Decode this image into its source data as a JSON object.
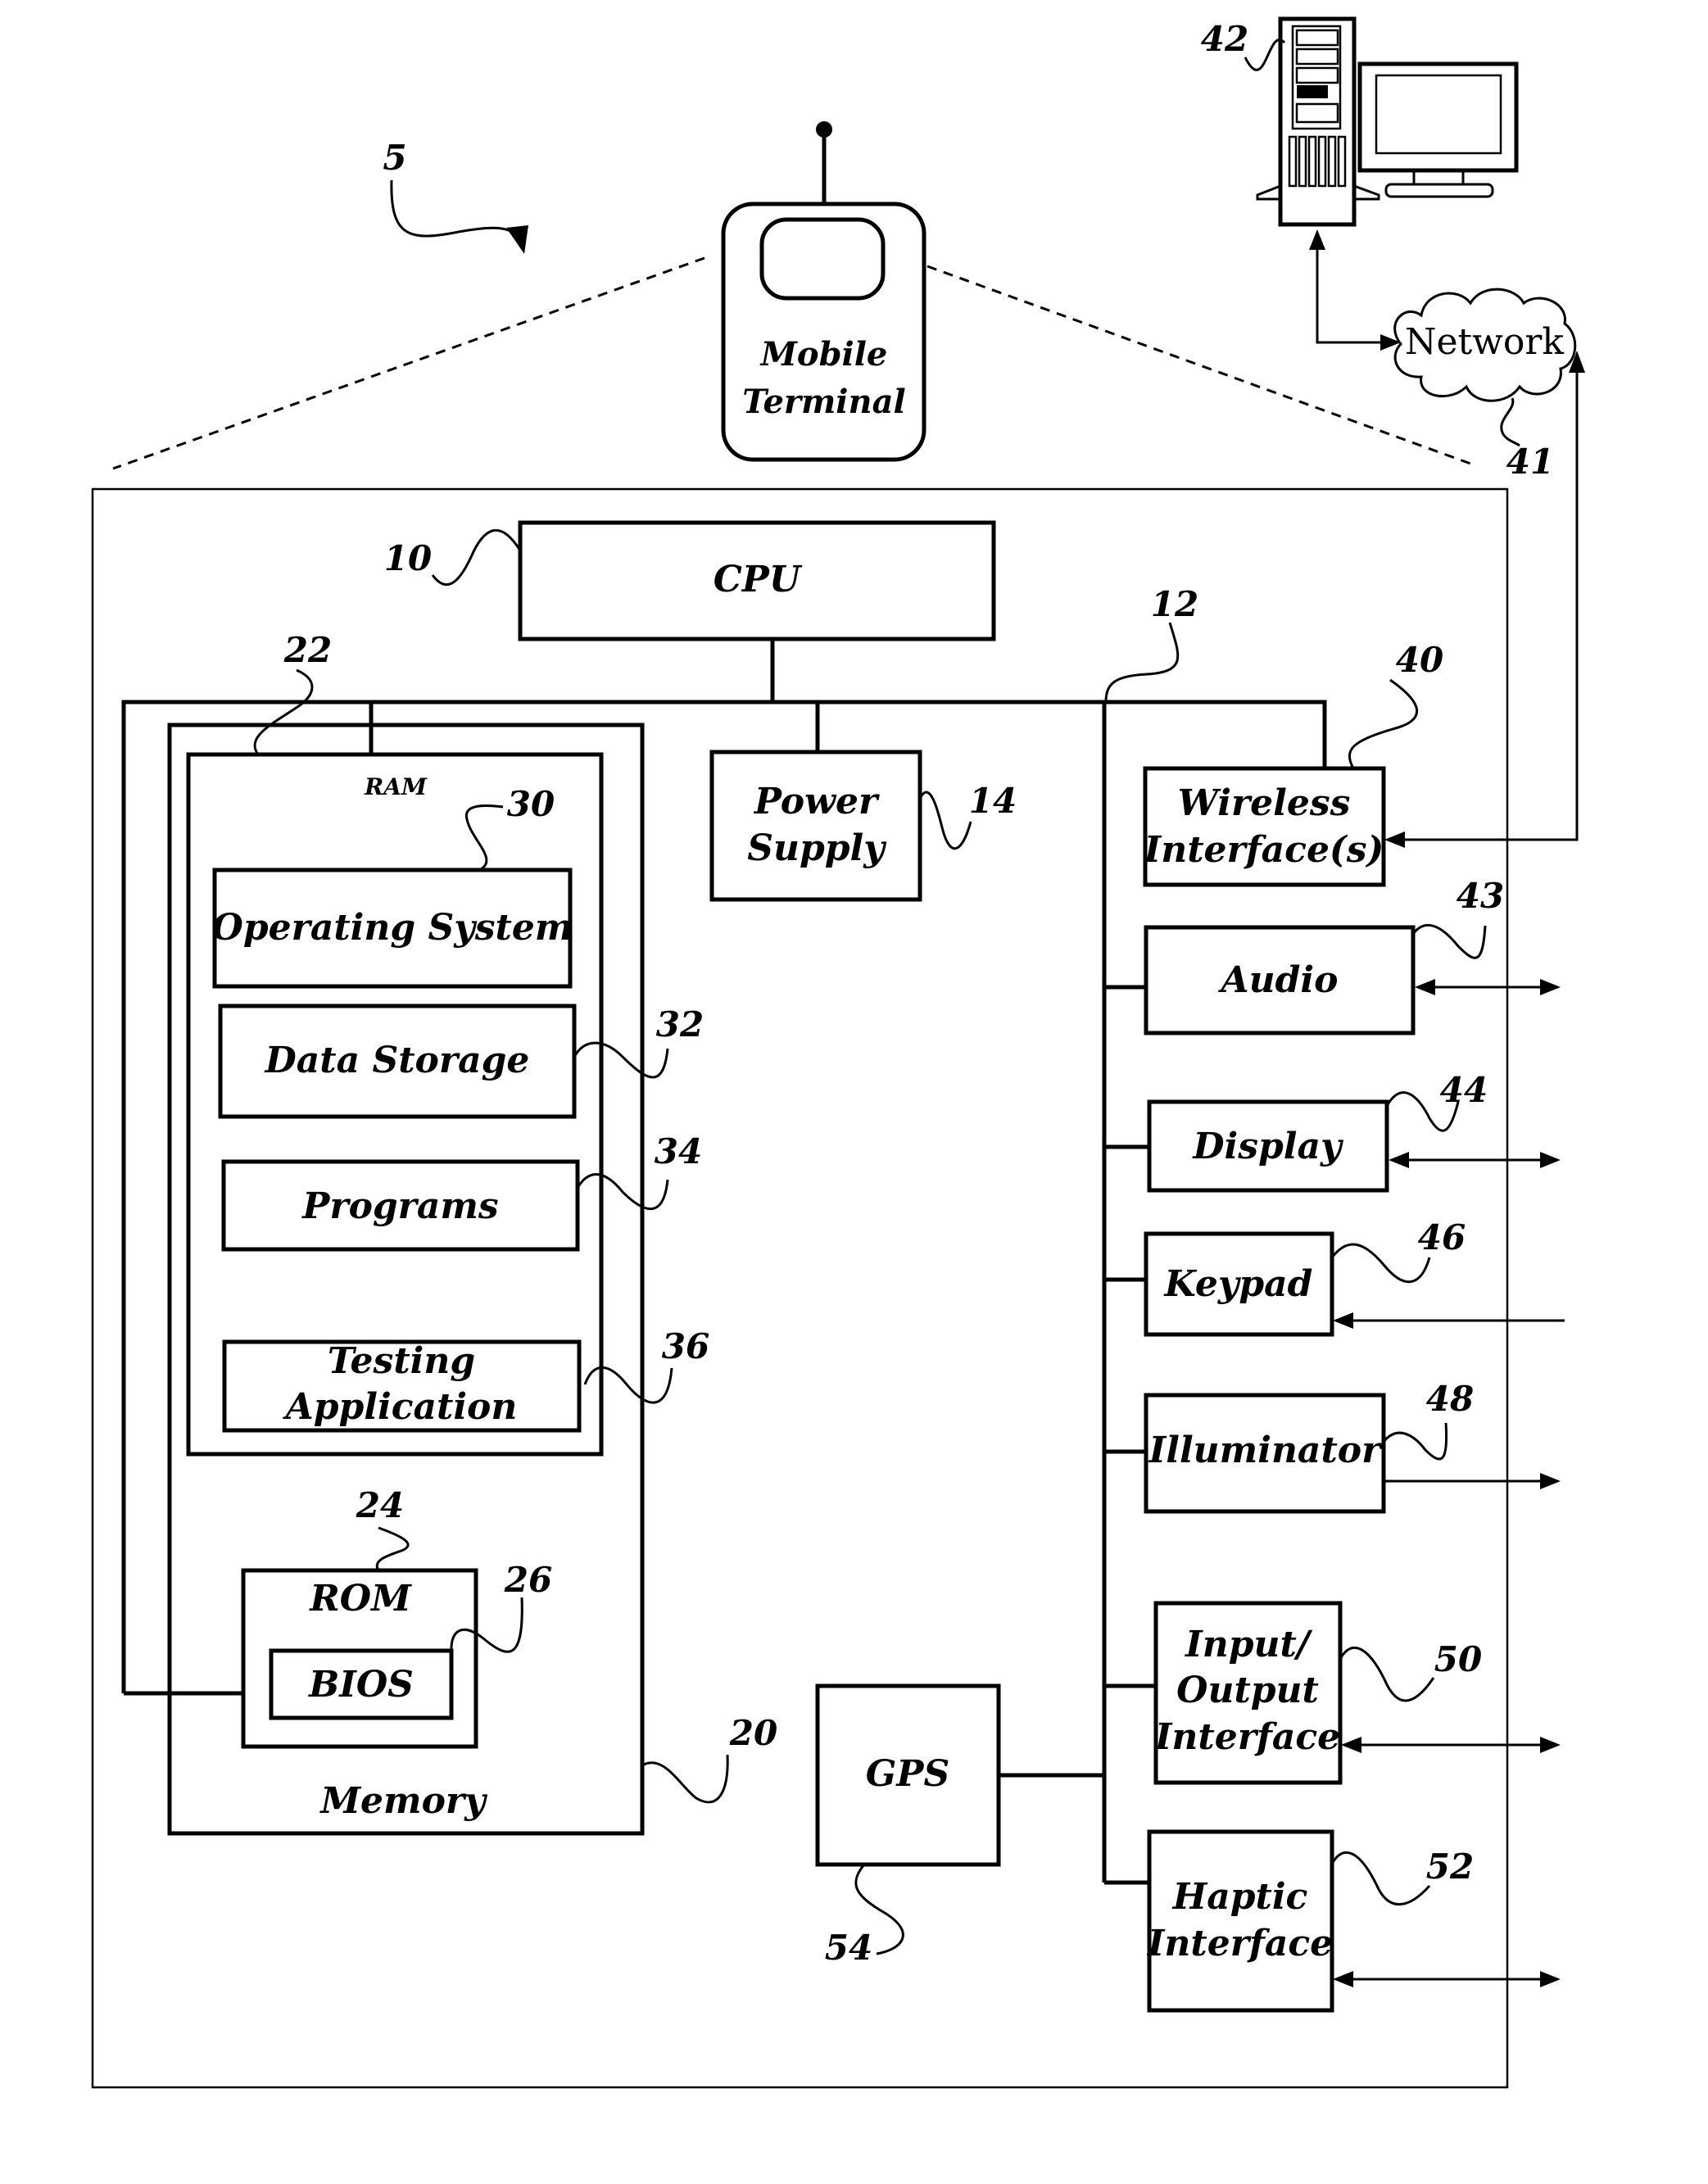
{
  "figure": {
    "system_ref": "5",
    "mobile_terminal": {
      "line1": "Mobile",
      "line2": "Terminal"
    },
    "server": {
      "ref": "42"
    },
    "network": {
      "label": "Network",
      "ref": "41"
    },
    "cpu": {
      "label": "CPU",
      "ref": "10"
    },
    "bus": {
      "ref": "12",
      "memory_bus_ref": "22"
    },
    "power_supply": {
      "line1": "Power",
      "line2": "Supply",
      "ref": "14"
    },
    "memory": {
      "label": "Memory",
      "ref": "20",
      "ram": {
        "label": "RAM",
        "items": [
          {
            "label": "Operating System",
            "ref": "30"
          },
          {
            "label": "Data Storage",
            "ref": "32"
          },
          {
            "label": "Programs",
            "ref": "34"
          },
          {
            "line1": "Testing",
            "line2": "Application",
            "ref": "36"
          }
        ]
      },
      "rom": {
        "label": "ROM",
        "ref": "24",
        "bios": {
          "label": "BIOS",
          "ref": "26"
        }
      }
    },
    "gps": {
      "label": "GPS",
      "ref": "54"
    },
    "peripherals": {
      "wireless": {
        "line1": "Wireless",
        "line2": "Interface(s)",
        "ref": "40"
      },
      "audio": {
        "label": "Audio",
        "ref": "43"
      },
      "display": {
        "label": "Display",
        "ref": "44"
      },
      "keypad": {
        "label": "Keypad",
        "ref": "46"
      },
      "illuminator": {
        "label": "Illuminator",
        "ref": "48"
      },
      "io": {
        "line1": "Input/",
        "line2": "Output",
        "line3": "Interface",
        "ref": "50"
      },
      "haptic": {
        "line1": "Haptic",
        "line2": "Interface",
        "ref": "52"
      }
    }
  }
}
